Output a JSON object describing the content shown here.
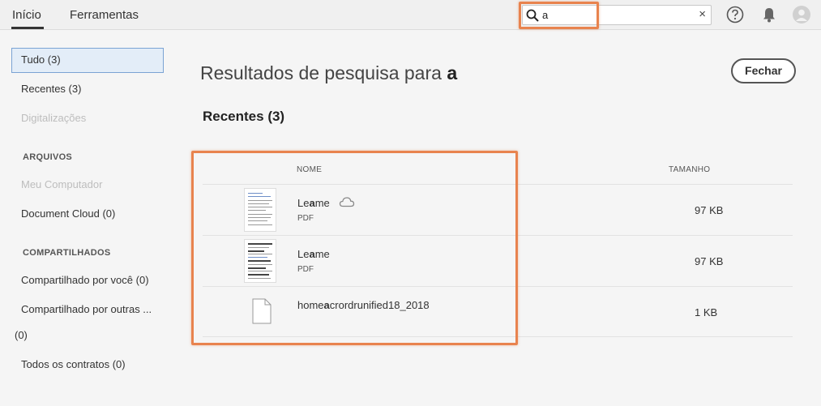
{
  "tabs": {
    "home": "Início",
    "tools": "Ferramentas"
  },
  "search": {
    "value": "a",
    "clear": "×"
  },
  "sidebar": {
    "items": [
      {
        "label": "Tudo (3)"
      },
      {
        "label": "Recentes (3)"
      },
      {
        "label": "Digitalizações"
      }
    ],
    "files_heading": "ARQUIVOS",
    "files_items": [
      {
        "label": "Meu Computador"
      },
      {
        "label": "Document Cloud (0)"
      }
    ],
    "shared_heading": "COMPARTILHADOS",
    "shared_items": [
      {
        "label": "Compartilhado por você (0)"
      },
      {
        "label": "Compartilhado por outras ..."
      },
      {
        "label": "(0)"
      },
      {
        "label": "Todos os contratos (0)"
      }
    ]
  },
  "main": {
    "title_prefix": "Resultados de pesquisa para ",
    "title_query": "a",
    "close_label": "Fechar",
    "section_title": "Recentes (3)",
    "columns": {
      "name": "NOME",
      "size": "TAMANHO"
    },
    "rows": [
      {
        "name_pre": "Le",
        "name_match": "a",
        "name_post": "me",
        "type": "PDF",
        "size": "97 KB"
      },
      {
        "name_pre": "Le",
        "name_match": "a",
        "name_post": "me",
        "type": "PDF",
        "size": "97 KB"
      },
      {
        "name_pre": "home",
        "name_match": "a",
        "name_post": "crordrunified18_2018",
        "type": "",
        "size": "1 KB"
      }
    ]
  },
  "colors": {
    "highlight": "#e8834e",
    "selected_bg": "#e3edf8",
    "selected_border": "#7aa3d4"
  }
}
